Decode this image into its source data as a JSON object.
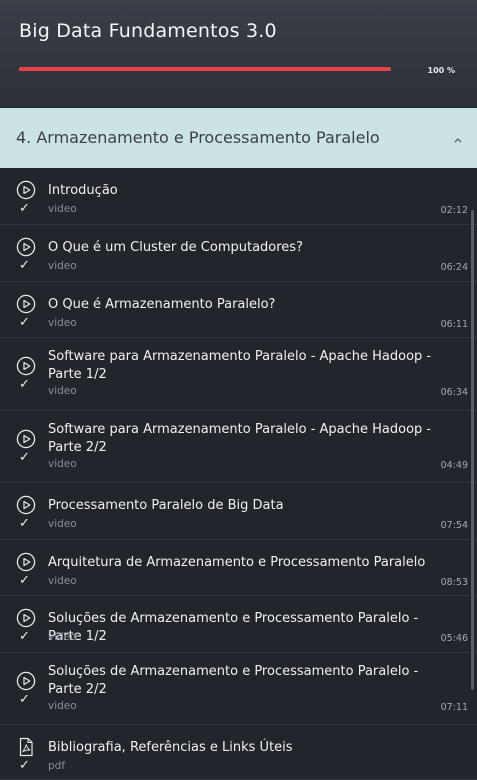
{
  "course": {
    "title": "Big Data Fundamentos 3.0",
    "progress_label": "100 %",
    "progress_fraction": 1.0,
    "accent_color": "#e8434a"
  },
  "section": {
    "title": "4. Armazenamento e Processamento Paralelo",
    "toggle_icon": "chevron-up-icon"
  },
  "lessons": [
    {
      "title": "Introdução",
      "type": "video",
      "duration": "02:12",
      "icon": "play-circle-icon",
      "completed": true
    },
    {
      "title": "O Que é um Cluster de Computadores?",
      "type": "video",
      "duration": "06:24",
      "icon": "play-circle-icon",
      "completed": true
    },
    {
      "title": "O Que é Armazenamento Paralelo?",
      "type": "video",
      "duration": "06:11",
      "icon": "play-circle-icon",
      "completed": true
    },
    {
      "title": "Software para Armazenamento Paralelo - Apache Hadoop - Parte 1/2",
      "type": "video",
      "duration": "06:34",
      "icon": "play-circle-icon",
      "completed": true
    },
    {
      "title": "Software para Armazenamento Paralelo - Apache Hadoop - Parte 2/2",
      "type": "video",
      "duration": "04:49",
      "icon": "play-circle-icon",
      "completed": true
    },
    {
      "title": "Processamento Paralelo de Big Data",
      "type": "video",
      "duration": "07:54",
      "icon": "play-circle-icon",
      "completed": true
    },
    {
      "title": "Arquitetura de Armazenamento e Processamento Paralelo",
      "type": "video",
      "duration": "08:53",
      "icon": "play-circle-icon",
      "completed": true
    },
    {
      "title": "Soluções de Armazenamento e Processamento Paralelo - Parte 1/2",
      "type": "video",
      "duration": "05:46",
      "icon": "play-circle-icon",
      "completed": true
    },
    {
      "title": "Soluções de Armazenamento e Processamento Paralelo - Parte 2/2",
      "type": "video",
      "duration": "07:11",
      "icon": "play-circle-icon",
      "completed": true
    },
    {
      "title": "Bibliografia, Referências e Links Úteis",
      "type": "pdf",
      "duration": "",
      "icon": "pdf-file-icon",
      "completed": true
    }
  ]
}
